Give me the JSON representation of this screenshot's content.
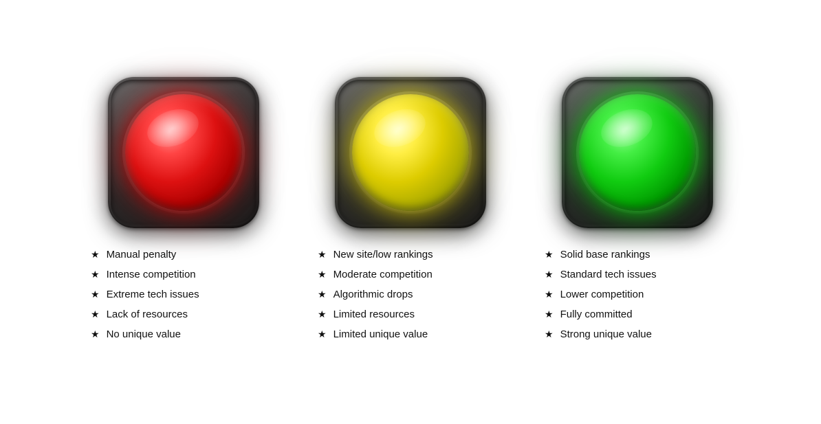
{
  "columns": [
    {
      "id": "red",
      "color": "red",
      "items": [
        "Manual penalty",
        "Intense competition",
        "Extreme tech issues",
        "Lack of resources",
        "No unique value"
      ]
    },
    {
      "id": "yellow",
      "color": "yellow",
      "items": [
        "New site/low rankings",
        "Moderate competition",
        "Algorithmic drops",
        "Limited resources",
        "Limited unique value"
      ]
    },
    {
      "id": "green",
      "color": "green",
      "items": [
        "Solid base rankings",
        "Standard tech issues",
        "Lower competition",
        "Fully committed",
        "Strong unique value"
      ]
    }
  ]
}
